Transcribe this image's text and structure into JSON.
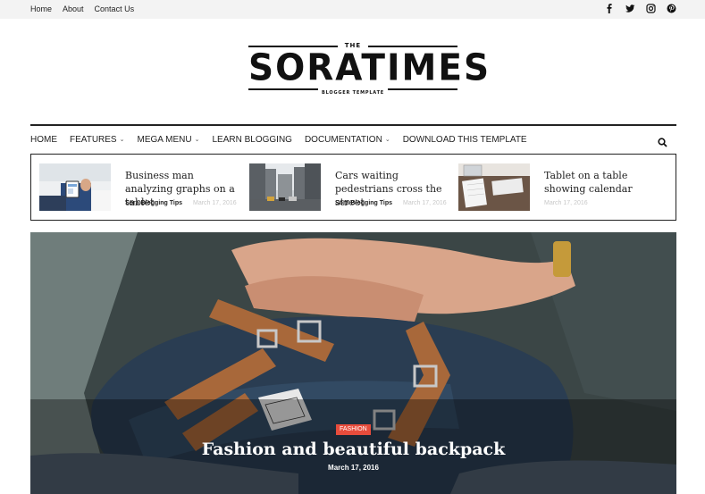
{
  "topbar": {
    "links": [
      "Home",
      "About",
      "Contact Us"
    ],
    "social": [
      "facebook-icon",
      "twitter-icon",
      "instagram-icon",
      "pinterest-icon"
    ]
  },
  "logo": {
    "the": "THE",
    "name": "SORATIMES",
    "tagline": "BLOGGER TEMPLATE"
  },
  "nav": {
    "items": [
      {
        "label": "HOME",
        "dropdown": false
      },
      {
        "label": "FEATURES",
        "dropdown": true
      },
      {
        "label": "MEGA MENU",
        "dropdown": true
      },
      {
        "label": "LEARN BLOGGING",
        "dropdown": false
      },
      {
        "label": "DOCUMENTATION",
        "dropdown": true
      },
      {
        "label": "DOWNLOAD THIS TEMPLATE",
        "dropdown": false
      }
    ],
    "search_icon": "search-icon"
  },
  "featured": [
    {
      "title": "Business man analyzing graphs on a tablet",
      "author": "Sora Blogging Tips",
      "date": "March 17, 2016"
    },
    {
      "title": "Cars waiting pedestrians cross the street",
      "author": "Sora Blogging Tips",
      "date": "March 17, 2016"
    },
    {
      "title": "Tablet on a table showing calendar",
      "author": "",
      "date": "March 17, 2016"
    }
  ],
  "hero": {
    "label": "FASHION",
    "title": "Fashion and beautiful backpack",
    "date": "March 17, 2016"
  },
  "colors": {
    "accent": "#e74c3c",
    "text": "#222222",
    "topbar_bg": "#f3f3f3"
  }
}
